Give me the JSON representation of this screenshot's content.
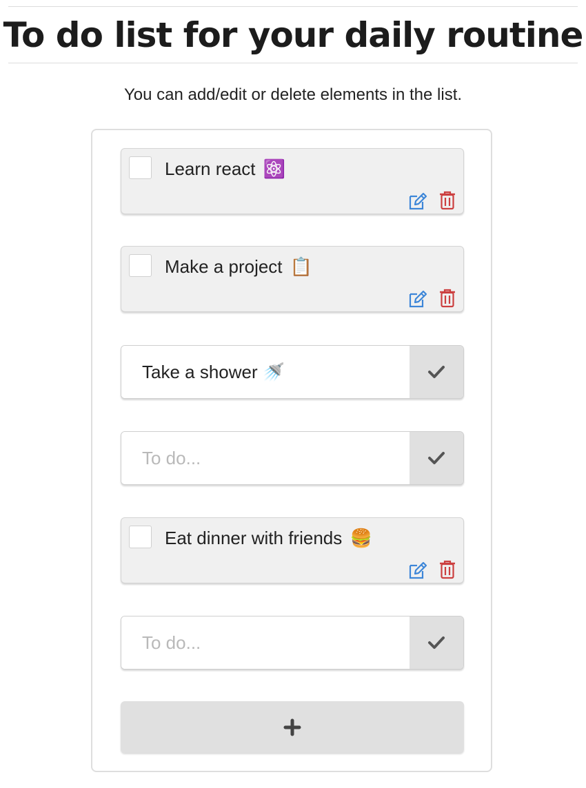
{
  "header": {
    "title": "To do list for your daily routine"
  },
  "subtitle": "You can add/edit or delete elements in the list.",
  "todos": [
    {
      "label": "Learn react",
      "emoji": "⚛️",
      "checked": false
    },
    {
      "label": "Make a project",
      "emoji": "📋",
      "checked": false
    },
    {
      "value": "Take a shower 🚿",
      "placeholder": "To do..."
    },
    {
      "value": "",
      "placeholder": "To do..."
    },
    {
      "label": "Eat dinner with friends",
      "emoji": "🍔",
      "checked": false
    },
    {
      "value": "",
      "placeholder": "To do..."
    }
  ],
  "icons": {
    "edit": "edit-icon",
    "delete": "trash-icon",
    "confirm": "check-icon",
    "add": "plus-icon"
  },
  "colors": {
    "edit_icon": "#3d86d8",
    "delete_icon": "#cc3f3f",
    "check_icon": "#555555"
  }
}
